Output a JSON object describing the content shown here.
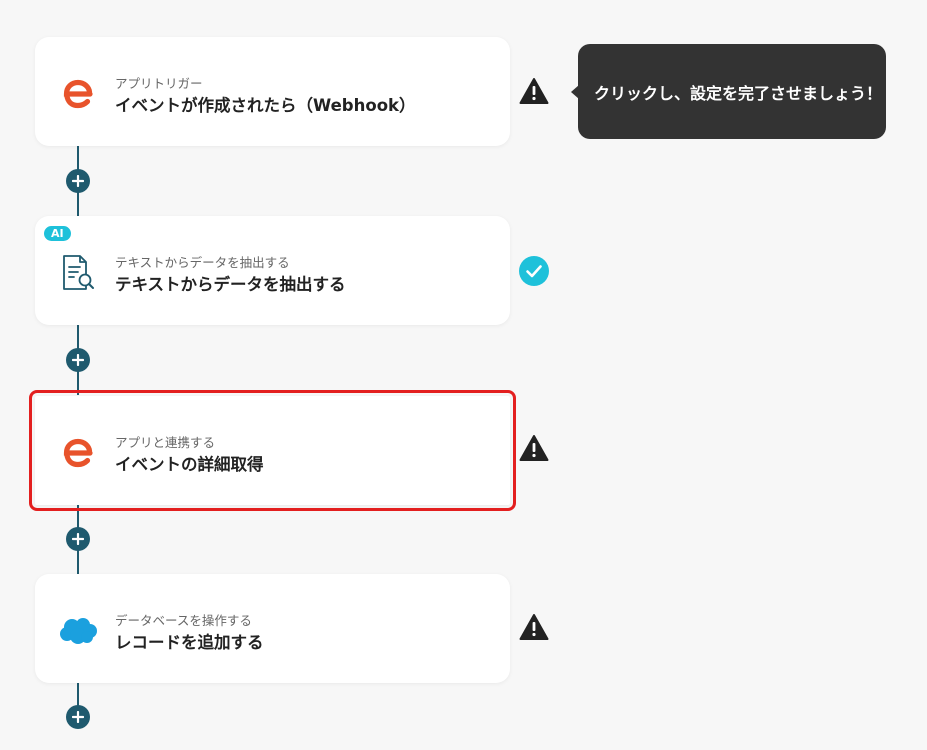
{
  "colors": {
    "connector": "#1f5a6e",
    "ai_badge": "#1ec1da",
    "selected_border": "#e31f1f",
    "tooltip_bg": "#333333",
    "check": "#1ec1da"
  },
  "steps": [
    {
      "app_icon": "eventbrite-e-icon",
      "sub": "アプリトリガー",
      "title": "イベントが作成されたら（Webhook）",
      "status": "warning-icon"
    },
    {
      "app_icon": "document-search-icon",
      "badge": "AI",
      "sub": "テキストからデータを抽出する",
      "title": "テキストからデータを抽出する",
      "status": "check-icon"
    },
    {
      "app_icon": "eventbrite-e-icon",
      "sub": "アプリと連携する",
      "title": "イベントの詳細取得",
      "status": "warning-icon",
      "selected": true
    },
    {
      "app_icon": "salesforce-cloud-icon",
      "sub": "データベースを操作する",
      "title": "レコードを追加する",
      "status": "warning-icon"
    }
  ],
  "tooltip": {
    "text": "クリックし、設定を完了させましょう！"
  }
}
